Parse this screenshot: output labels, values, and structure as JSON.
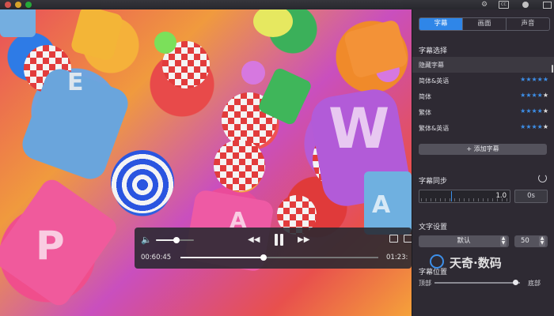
{
  "window": {
    "traffic_lights": [
      "#f25c55",
      "#f7bb2c",
      "#28c23e"
    ]
  },
  "player": {
    "elapsed": "00:60:45",
    "remaining": "01:23:",
    "progress": 0.42,
    "volume": 0.55
  },
  "panel": {
    "tabs": [
      {
        "label": "字幕",
        "active": true
      },
      {
        "label": "画面",
        "active": false
      },
      {
        "label": "声音",
        "active": false
      }
    ],
    "subtitle_select_title": "字幕选择",
    "subtitles": [
      {
        "label": "隐藏字幕",
        "selected": true,
        "rating": 0
      },
      {
        "label": "简体&英语",
        "selected": false,
        "rating": 5
      },
      {
        "label": "简体",
        "selected": false,
        "rating": 4
      },
      {
        "label": "繁体",
        "selected": false,
        "rating": 4
      },
      {
        "label": "繁体&英语",
        "selected": false,
        "rating": 4
      }
    ],
    "add_subtitle_label": "+ 添加字幕",
    "sync_title": "字幕同步",
    "sync_value": "1.0",
    "sync_seconds": "0s",
    "text_settings_title": "文字设置",
    "font_select": "默认",
    "font_size": "50",
    "position_title": "字幕位置",
    "position_top": "顶部",
    "position_bottom": "底部",
    "position_value": 0.95,
    "watermark": "天奇·数码"
  },
  "colors": {
    "accent": "#2f86e8",
    "star_on": "#3d8fe8"
  }
}
